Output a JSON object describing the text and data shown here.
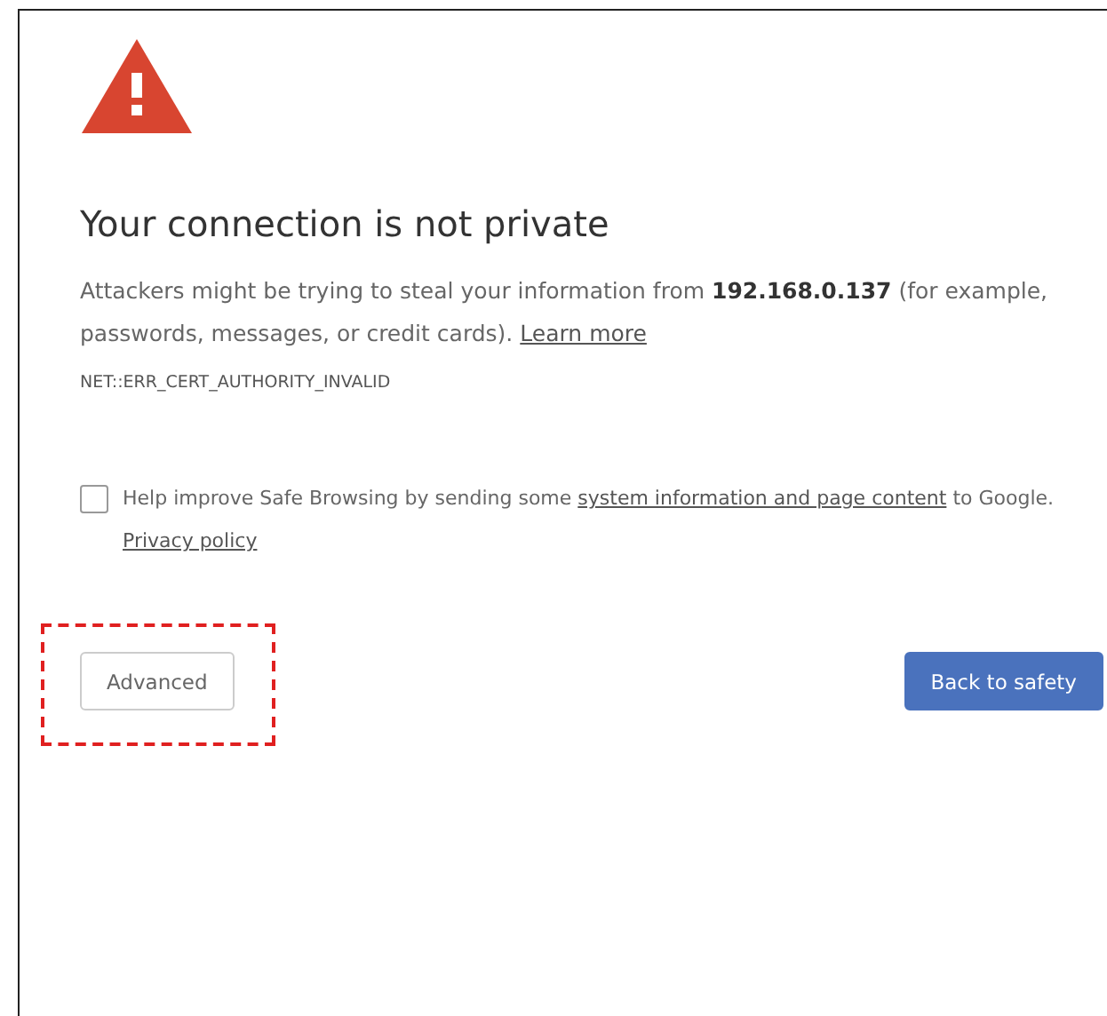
{
  "heading": "Your connection is not private",
  "description": {
    "text": "Attackers might be trying to steal your information from **192.168.0.137** (for example, passwords, messages, or credit cards).",
    "link": "Learn more"
  },
  "error_code": "NET::ERR_CERT_AUTHORITY_INVALID",
  "safe_browsing": {
    "checked": false,
    "before": "Help improve Safe Browsing by sending some",
    "link": "system information and page content",
    "after": "to Google.",
    "privacy_link": "Privacy policy"
  },
  "buttons": [
    {
      "label": "Advanced",
      "kind": "secondary",
      "highlighted": true
    },
    {
      "label": "Back to safety",
      "kind": "primary",
      "highlighted": false
    }
  ]
}
